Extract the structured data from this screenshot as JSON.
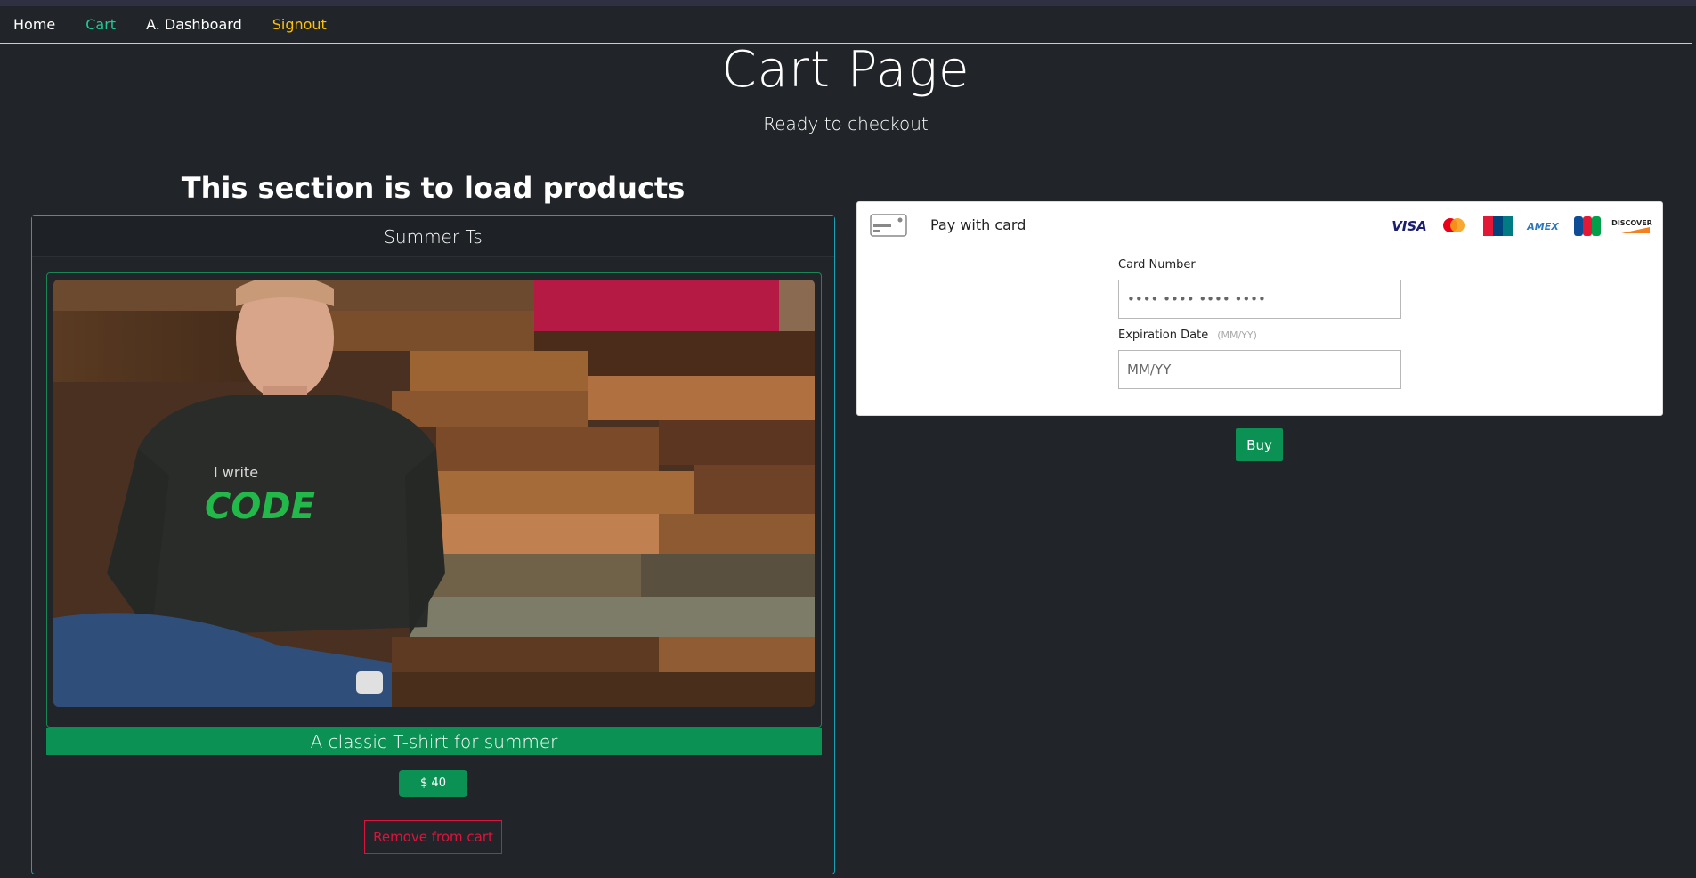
{
  "nav": {
    "items": [
      {
        "label": "Home",
        "color": "#ffffff"
      },
      {
        "label": "Cart",
        "color": "#20c997"
      },
      {
        "label": "A. Dashboard",
        "color": "#ffffff"
      },
      {
        "label": "Signout",
        "color": "#ffc107"
      }
    ]
  },
  "header": {
    "title": "Cart Page",
    "subtitle": "Ready to checkout"
  },
  "products_section": {
    "heading": "This section is to load products",
    "product": {
      "name": "Summer Ts",
      "image_icon": "t-shirt-photo",
      "image_text_line1": "I write",
      "image_text_line2": "CODE",
      "description": "A classic T-shirt for summer",
      "price": "$ 40",
      "remove_label": "Remove from cart"
    }
  },
  "payment": {
    "title": "Pay with card",
    "card_icon": "credit-card-icon",
    "brands": [
      "VISA",
      "mastercard",
      "UnionPay",
      "AMEX",
      "JCB",
      "DISCOVER"
    ],
    "card_number": {
      "label": "Card Number",
      "placeholder": "•••• •••• •••• ••••"
    },
    "expiration": {
      "label": "Expiration Date",
      "hint": "(MM/YY)",
      "placeholder": "MM/YY"
    },
    "buy_label": "Buy"
  },
  "colors": {
    "background": "#212529",
    "accent_green": "#0b9154",
    "card_border": "#17a2b8",
    "remove_red": "#dc143c"
  }
}
